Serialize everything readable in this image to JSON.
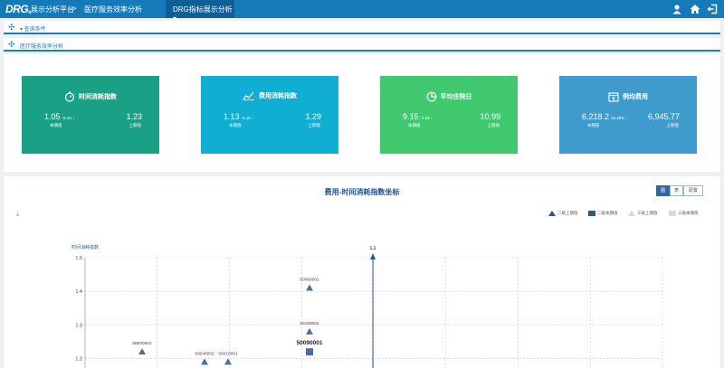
{
  "topbar": {
    "logo": "DRG",
    "logo_sub": "s",
    "app_name": "展示分析平台",
    "separator": ">",
    "breadcrumb": "医疗服务效率分析",
    "dropdown": "DRG指标展示分析 ▾",
    "icons": [
      "user-icon",
      "home-icon",
      "logout-icon"
    ]
  },
  "panels": {
    "query": "▾ 查询条件",
    "efficiency": "医疗服务效率分析"
  },
  "cards": [
    {
      "title": "时间消耗指数",
      "icon": "stopwatch-icon",
      "color": "#1aa085",
      "current": "1.05",
      "delta": "-0.18 ↓",
      "previous": "1.23",
      "current_label": "本期值",
      "previous_label": "上期值"
    },
    {
      "title": "费用消耗指数",
      "icon": "line-chart-icon",
      "color": "#11aed3",
      "current": "1.13",
      "delta": "-0.16 ↓",
      "previous": "1.29",
      "current_label": "本期值",
      "previous_label": "上期值"
    },
    {
      "title": "平均住院日",
      "icon": "pie-chart-icon",
      "color": "#40c96f",
      "current": "9.15",
      "delta": "-1.84 ↓",
      "previous": "10.99",
      "current_label": "本期值",
      "previous_label": "上期值"
    },
    {
      "title": "例均费用",
      "icon": "payment-icon",
      "color": "#3f9bcc",
      "current": "6,218.2",
      "delta": "10.48% ↓",
      "previous": "6,945.77",
      "current_label": "本期值",
      "previous_label": "上期值"
    }
  ],
  "chart_section": {
    "title": "费用-时间消耗指数坐标",
    "toggles": [
      "图",
      "表",
      "配置"
    ],
    "active_toggle": "图",
    "download_icon": "download-icon",
    "legend": [
      {
        "name": "二级上期值",
        "marker": "triangle",
        "color": "#2f5686"
      },
      {
        "name": "二级本期值",
        "marker": "square",
        "color": "#2f5686"
      },
      {
        "name": "三级上期值",
        "marker": "triangle",
        "color": "#dadada"
      },
      {
        "name": "三级本期值",
        "marker": "square",
        "color": "#dadada"
      }
    ]
  },
  "chart_data": {
    "type": "scatter",
    "ylabel": "时间消耗指数",
    "yticks": [
      "1.5",
      "1.4",
      "1.3",
      "1.2"
    ],
    "ylim": [
      1.18,
      1.5
    ],
    "grid": true,
    "reference_line": {
      "label": "1.1"
    },
    "series": [
      {
        "name": "二级上期值",
        "marker": "triangle",
        "points": [
          {
            "label": "50000002",
            "y": 1.22
          },
          {
            "label": "50040002",
            "y": 1.19
          },
          {
            "label": "50010001",
            "y": 1.19
          },
          {
            "label": "50090001",
            "y": 1.41
          },
          {
            "label": "50100001",
            "y": 1.28
          }
        ]
      },
      {
        "name": "二级本期值",
        "marker": "square",
        "points": [
          {
            "label": "50090001",
            "y": 1.22
          }
        ]
      }
    ]
  }
}
